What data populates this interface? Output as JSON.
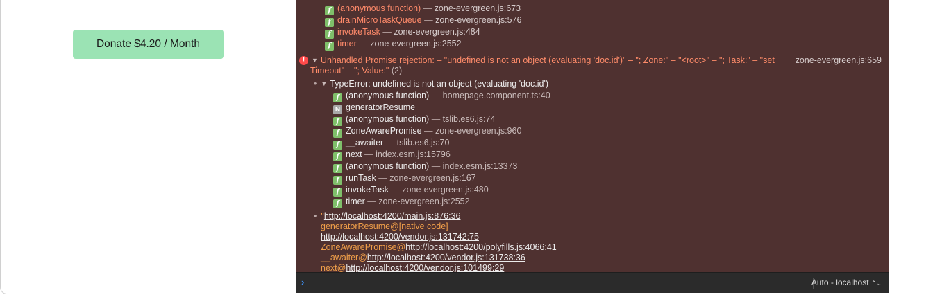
{
  "donate": {
    "label": "Donate $4.20 / Month"
  },
  "console": {
    "top_frames": [
      {
        "fn": "(anonymous function)",
        "loc": "zone-evergreen.js:673"
      },
      {
        "fn": "drainMicroTaskQueue",
        "loc": "zone-evergreen.js:576"
      },
      {
        "fn": "invokeTask",
        "loc": "zone-evergreen.js:484"
      },
      {
        "fn": "timer",
        "loc": "zone-evergreen.js:2552"
      }
    ],
    "error": {
      "line1": "Unhandled Promise rejection: – \"undefined is not an object (evaluating 'doc.id')\" – \"; Zone:\" – \"<root>\" – \"; Task:\" – \"set",
      "line2": "Timeout\" – \"; Value:\"",
      "count": "(2)",
      "source": "zone-evergreen.js:659"
    },
    "type_error": "TypeError: undefined is not an object (evaluating 'doc.id')",
    "stack": [
      {
        "badge": "f",
        "fn": "(anonymous function)",
        "loc": "homepage.component.ts:40"
      },
      {
        "badge": "N",
        "fn": "generatorResume",
        "loc": ""
      },
      {
        "badge": "f",
        "fn": "(anonymous function)",
        "loc": "tslib.es6.js:74"
      },
      {
        "badge": "f",
        "fn": "ZoneAwarePromise",
        "loc": "zone-evergreen.js:960"
      },
      {
        "badge": "f",
        "fn": "__awaiter",
        "loc": "tslib.es6.js:70"
      },
      {
        "badge": "f",
        "fn": "next",
        "loc": "index.esm.js:15796"
      },
      {
        "badge": "f",
        "fn": "(anonymous function)",
        "loc": "index.esm.js:13373"
      },
      {
        "badge": "f",
        "fn": "runTask",
        "loc": "zone-evergreen.js:167"
      },
      {
        "badge": "f",
        "fn": "invokeTask",
        "loc": "zone-evergreen.js:480"
      },
      {
        "badge": "f",
        "fn": "timer",
        "loc": "zone-evergreen.js:2552"
      }
    ],
    "trace": {
      "line1_quote": "\"",
      "line1_link": "http://localhost:4200/main.js:876:36",
      "line2": "generatorResume@[native code]",
      "line3_link": "http://localhost:4200/vendor.js:131742:75",
      "line4_prefix": "ZoneAwarePromise@",
      "line4_link": "http://localhost:4200/polyfills.js:4066:41",
      "line5_prefix": "__awaiter@",
      "line5_link": "http://localhost:4200/vendor.js:131738:36",
      "line6_prefix": "next@",
      "line6_link": "http://localhost:4200/vendor.js:101499:29"
    },
    "separator": "—",
    "bullet": "•"
  },
  "input_bar": {
    "prompt": "›",
    "context": "Auto - localhost",
    "context_icon": "⌃⌄"
  },
  "colors": {
    "console_bg": "#4f3130",
    "button_bg": "#9be3b4",
    "error_red": "#ff8c6a",
    "link_orange": "#f2a04a"
  }
}
